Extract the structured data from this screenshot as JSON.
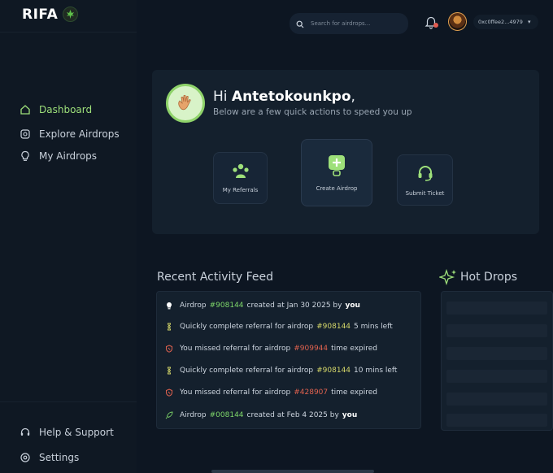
{
  "brand": {
    "logo": "RIFA"
  },
  "sidebar": {
    "nav": [
      {
        "label": "Dashboard",
        "icon": "home-icon",
        "active": true
      },
      {
        "label": "Explore Airdrops",
        "icon": "explore-icon",
        "active": false
      },
      {
        "label": "My Airdrops",
        "icon": "bulb-icon",
        "active": false
      }
    ],
    "footer": [
      {
        "label": "Help & Support",
        "icon": "headset-icon"
      },
      {
        "label": "Settings",
        "icon": "gear-icon"
      }
    ]
  },
  "header": {
    "search_placeholder": "Search for airdrops...",
    "wallet": "0xc0ffee2...4979"
  },
  "welcome": {
    "greeting_prefix": "Hi ",
    "name": "Antetokounkpo",
    "greeting_suffix": ",",
    "subtitle": "Below are a few quick actions to speed you up",
    "actions": [
      {
        "label": "My Referrals",
        "icon": "referrals-icon"
      },
      {
        "label": "Create Airdrop",
        "icon": "create-airdrop-icon"
      },
      {
        "label": "Submit Ticket",
        "icon": "support-ticket-icon"
      }
    ]
  },
  "feed": {
    "title": "Recent Activity Feed",
    "items": [
      {
        "icon": "bulb-icon",
        "pre": "Airdrop",
        "tag": "#908144",
        "tag_color": "green",
        "post": "created at Jan 30 2025 by",
        "tail": "you"
      },
      {
        "icon": "timer-icon",
        "pre": "Quickly complete referral for airdrop",
        "tag": "#908144",
        "tag_color": "yellow",
        "post": "5 mins left",
        "tail": ""
      },
      {
        "icon": "shield-icon",
        "pre": "You missed referral for airdrop",
        "tag": "#909944",
        "tag_color": "red",
        "post": "time expired",
        "tail": ""
      },
      {
        "icon": "timer-icon",
        "pre": "Quickly complete referral for airdrop",
        "tag": "#908144",
        "tag_color": "yellow",
        "post": "10 mins left",
        "tail": ""
      },
      {
        "icon": "shield-icon",
        "pre": "You missed referral for airdrop",
        "tag": "#428907",
        "tag_color": "red",
        "post": "time expired",
        "tail": ""
      },
      {
        "icon": "rocket-icon",
        "pre": "Airdrop",
        "tag": "#008144",
        "tag_color": "green",
        "post": "created at Feb 4 2025 by",
        "tail": "you"
      }
    ]
  },
  "hot_drops": {
    "title": "Hot Drops"
  },
  "colors": {
    "accent": "#9ee07a",
    "green_tag": "#7fd86a",
    "red_tag": "#e0624f",
    "yellow_tag": "#d6d86a"
  }
}
